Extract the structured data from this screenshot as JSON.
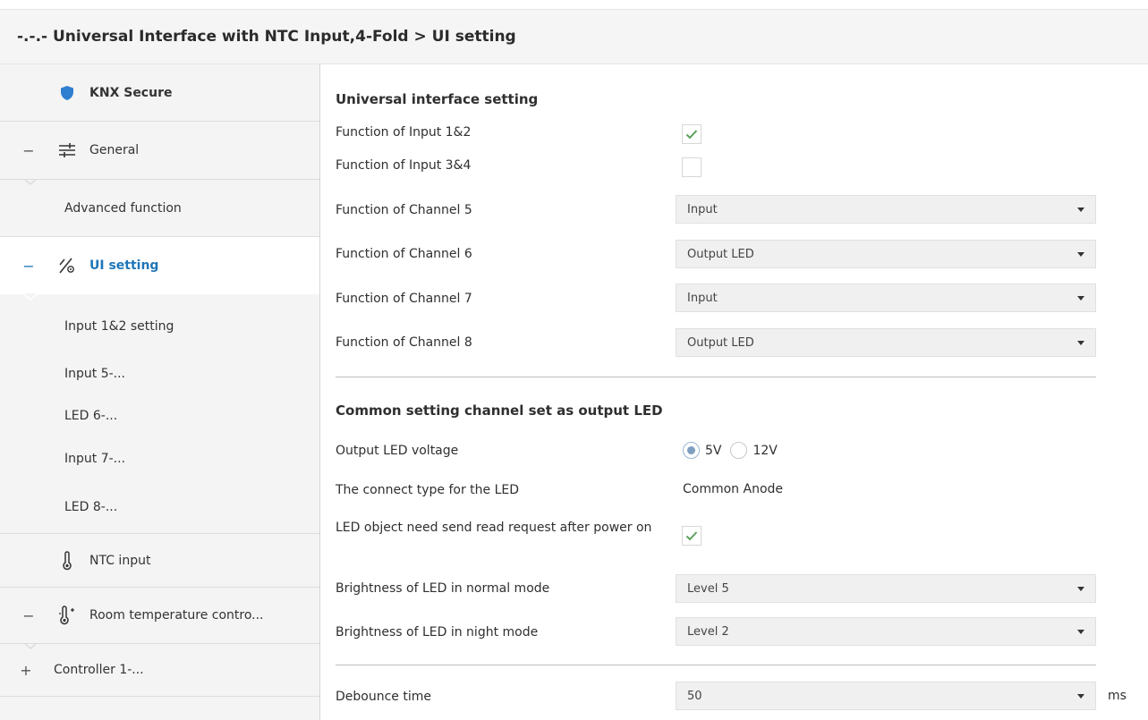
{
  "window": {
    "title": "-.-.- Universal Interface with NTC Input,4-Fold > UI setting"
  },
  "sidebar": {
    "items": [
      {
        "label": "KNX Secure",
        "icon": "shield-icon"
      },
      {
        "label": "General",
        "icon": "sliders-icon",
        "sign": "−"
      },
      {
        "label": "Advanced function"
      },
      {
        "label": "UI setting",
        "icon": "ui-setting-icon",
        "sign": "−"
      },
      {
        "label": "Input 1&2 setting"
      },
      {
        "label": "Input 5-..."
      },
      {
        "label": "LED 6-..."
      },
      {
        "label": "Input 7-..."
      },
      {
        "label": "LED 8-..."
      },
      {
        "label": "NTC input",
        "icon": "thermometer-icon"
      },
      {
        "label": "Room temperature contro...",
        "icon": "thermometer-icon",
        "sign": "−"
      },
      {
        "label": "Controller 1-...",
        "sign": "+"
      }
    ]
  },
  "main": {
    "section1": {
      "title": "Universal interface setting",
      "input12": {
        "label": "Function of Input 1&2",
        "checked": true
      },
      "input34": {
        "label": "Function of Input 3&4",
        "checked": false
      },
      "ch5": {
        "label": "Function of Channel 5",
        "value": "Input"
      },
      "ch6": {
        "label": "Function of Channel 6",
        "value": "Output LED"
      },
      "ch7": {
        "label": "Function of Channel 7",
        "value": "Input"
      },
      "ch8": {
        "label": "Function of Channel 8",
        "value": "Output LED"
      }
    },
    "section2": {
      "title": "Common setting channel set as output LED",
      "voltage": {
        "label": "Output LED voltage",
        "options": [
          "5V",
          "12V"
        ],
        "selected": "5V"
      },
      "connect": {
        "label": "The connect type for the LED",
        "value": "Common Anode"
      },
      "read_request": {
        "label": "LED object need send read request after power on",
        "checked": true
      },
      "normal": {
        "label": "Brightness of LED in normal mode",
        "value": "Level 5"
      },
      "night": {
        "label": "Brightness of LED in night mode",
        "value": "Level 2"
      }
    },
    "debounce": {
      "label": "Debounce time",
      "value": "50",
      "unit": "ms"
    }
  },
  "colors": {
    "accent": "#1f76b8",
    "check": "#5aa05a",
    "shield": "#2f7fd0"
  }
}
